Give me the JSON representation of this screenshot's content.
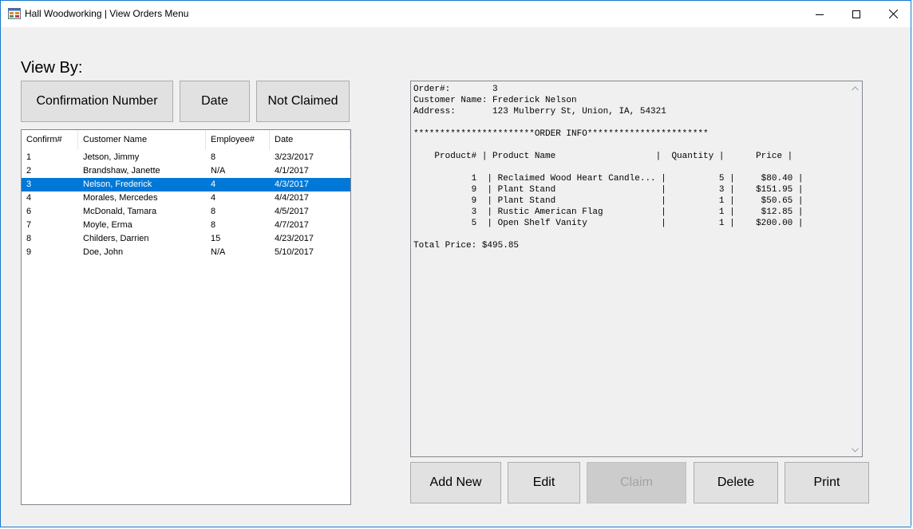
{
  "window": {
    "title": "Hall Woodworking | View Orders Menu",
    "icon": "app-form-icon",
    "controls": [
      "minimize-icon",
      "maximize-icon",
      "close-icon"
    ]
  },
  "view_by": {
    "label": "View By:",
    "buttons": [
      "Confirmation Number",
      "Date",
      "Not Claimed"
    ]
  },
  "orders_list": {
    "columns": [
      "Confirm#",
      "Customer Name",
      "Employee#",
      "Date"
    ],
    "rows": [
      {
        "confirm": "1",
        "customer": "Jetson, Jimmy",
        "employee": "8",
        "date": "3/23/2017"
      },
      {
        "confirm": "2",
        "customer": "Brandshaw, Janette",
        "employee": "N/A",
        "date": "4/1/2017"
      },
      {
        "confirm": "3",
        "customer": "Nelson, Frederick",
        "employee": "4",
        "date": "4/3/2017",
        "selected": true
      },
      {
        "confirm": "4",
        "customer": "Morales, Mercedes",
        "employee": "4",
        "date": "4/4/2017"
      },
      {
        "confirm": "6",
        "customer": "McDonald, Tamara",
        "employee": "8",
        "date": "4/5/2017"
      },
      {
        "confirm": "7",
        "customer": "Moyle, Erma",
        "employee": "8",
        "date": "4/7/2017"
      },
      {
        "confirm": "8",
        "customer": "Childers, Darrien",
        "employee": "15",
        "date": "4/23/2017"
      },
      {
        "confirm": "9",
        "customer": "Doe, John",
        "employee": "N/A",
        "date": "5/10/2017"
      }
    ],
    "selection_color": "#0078d7"
  },
  "order_details": {
    "text": "Order#:        3\nCustomer Name: Frederick Nelson\nAddress:       123 Mulberry St, Union, IA, 54321\n\n***********************ORDER INFO***********************\n\n    Product# | Product Name                   |  Quantity |      Price |\n\n           1  | Reclaimed Wood Heart Candle... |          5 |     $80.40 |\n           9  | Plant Stand                    |          3 |    $151.95 |\n           9  | Plant Stand                    |          1 |     $50.65 |\n           3  | Rustic American Flag           |          1 |     $12.85 |\n           5  | Open Shelf Vanity              |          1 |    $200.00 |\n\nTotal Price: $495.85"
  },
  "actions": {
    "add_new": "Add New",
    "edit": "Edit",
    "claim": "Claim",
    "delete": "Delete",
    "print": "Print"
  }
}
